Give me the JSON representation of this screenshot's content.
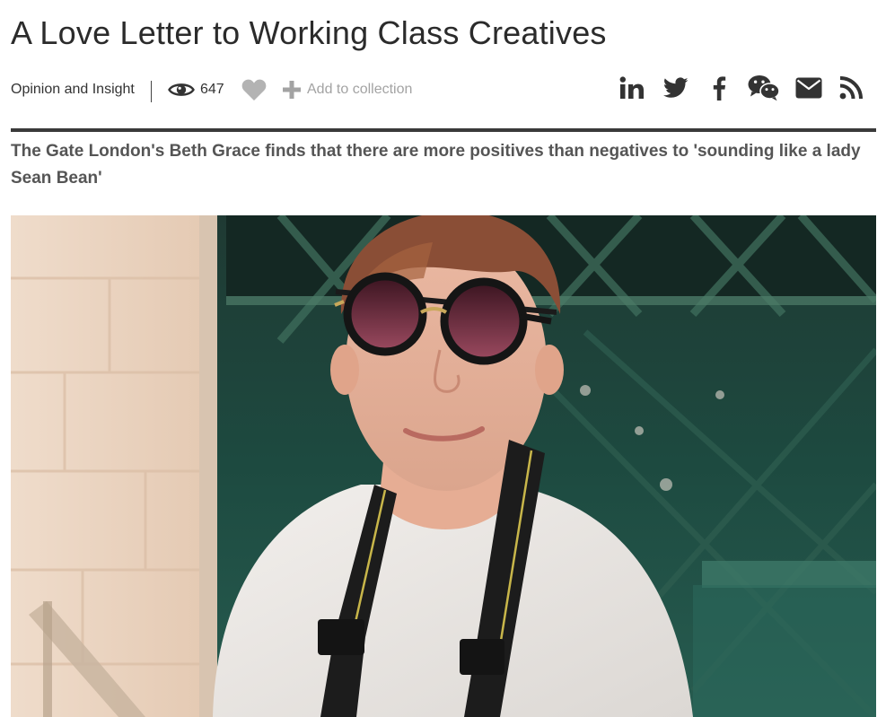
{
  "article": {
    "title": "A Love Letter to Working Class Creatives",
    "category": "Opinion and Insight",
    "views": "647",
    "collection_label": "Add to collection",
    "standfirst": "The Gate London's Beth Grace finds that there are more positives than negatives to 'sounding like a lady Sean Bean'"
  },
  "icons": {
    "views": "eye-icon",
    "like": "heart-icon",
    "collection": "plus-icon",
    "share": [
      "linkedin-icon",
      "twitter-icon",
      "facebook-icon",
      "wechat-icon",
      "email-icon",
      "rss-icon"
    ]
  },
  "colors": {
    "title": "#2b2b2b",
    "muted": "#a3a3a3",
    "icon": "#333333",
    "rule": "#3a3a3a",
    "standfirst": "#555555"
  }
}
